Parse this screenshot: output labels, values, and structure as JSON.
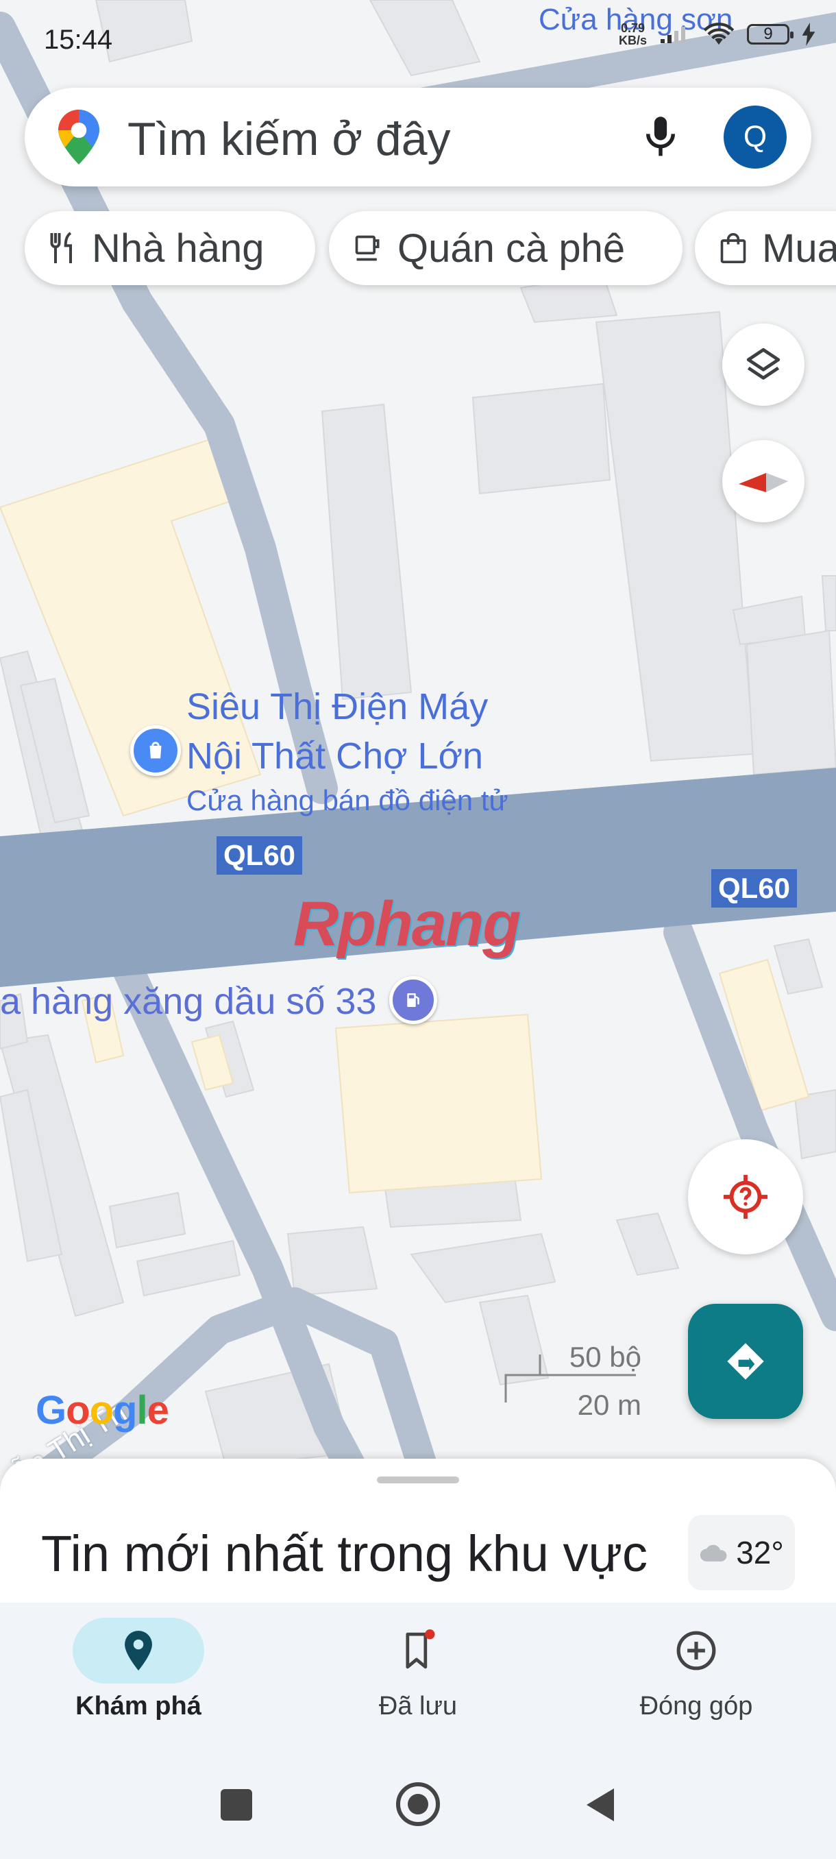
{
  "status_bar": {
    "time": "15:44",
    "net_speed_value": "0.79",
    "net_speed_unit": "KB/s",
    "battery_level": "9",
    "icons": [
      "signal-icon",
      "wifi-icon",
      "battery-icon",
      "charging-icon"
    ]
  },
  "search": {
    "placeholder": "Tìm kiếm ở đây",
    "icons": [
      "google-maps-pin-icon",
      "microphone-icon"
    ],
    "avatar_letter": "Q"
  },
  "chips": [
    {
      "label": "Nhà hàng",
      "icon": "restaurant-icon"
    },
    {
      "label": "Quán cà phê",
      "icon": "coffee-icon"
    },
    {
      "label": "Mua",
      "icon": "shopping-bag-icon"
    }
  ],
  "map": {
    "labels": {
      "top_store": "Cửa hàng sơn",
      "poi_name_line1": "Siêu Thị Điện Máy",
      "poi_name_line2": "Nội Thất Chợ Lớn",
      "poi_category": "Cửa hàng bán đồ điện tử",
      "gas_station": "a hàng xăng dầu số 33",
      "street": "ễn Thị Th",
      "watermark": "Rphang"
    },
    "route_shields": [
      "QL60",
      "QL60"
    ],
    "scale": {
      "top": "50 bộ",
      "bottom": "20 m"
    },
    "google_logo": "Google",
    "colors": {
      "road": "#b4c0cf",
      "highway": "#8ea3bd",
      "label": "#4a6fd8",
      "building": "#e6e7ea",
      "building_yellow": "#fcf4dd"
    }
  },
  "map_controls": [
    "layers-icon",
    "compass-icon",
    "my-location-icon",
    "directions-icon"
  ],
  "sheet": {
    "title": "Tin mới nhất trong khu vực",
    "weather": "32°",
    "weather_icon": "cloud-icon"
  },
  "bottom_nav": [
    {
      "label": "Khám phá",
      "icon": "explore-pin-icon",
      "active": true
    },
    {
      "label": "Đã lưu",
      "icon": "bookmark-icon",
      "active": false
    },
    {
      "label": "Đóng góp",
      "icon": "add-circle-icon",
      "active": false
    }
  ],
  "system_nav": [
    "recent-apps-icon",
    "home-icon",
    "back-icon"
  ]
}
